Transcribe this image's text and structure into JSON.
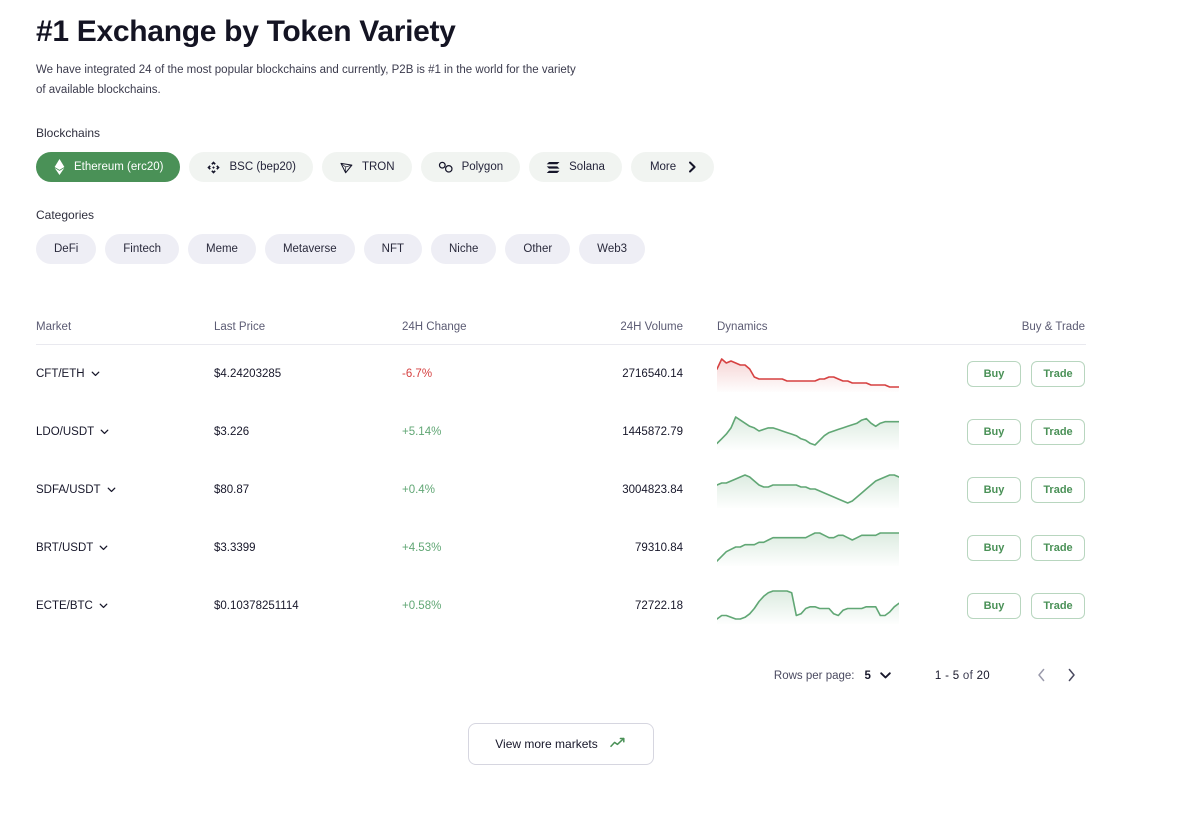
{
  "header": {
    "title": "#1 Exchange by Token Variety",
    "subtitle": "We have integrated 24 of the most popular blockchains and currently, P2B is #1 in the world for the variety of available blockchains."
  },
  "blockchains": {
    "label": "Blockchains",
    "items": [
      {
        "label": "Ethereum (erc20)",
        "icon": "ethereum-icon",
        "active": true
      },
      {
        "label": "BSC (bep20)",
        "icon": "bnb-icon",
        "active": false
      },
      {
        "label": "TRON",
        "icon": "tron-icon",
        "active": false
      },
      {
        "label": "Polygon",
        "icon": "polygon-icon",
        "active": false
      },
      {
        "label": "Solana",
        "icon": "solana-icon",
        "active": false
      }
    ],
    "more_label": "More"
  },
  "categories": {
    "label": "Categories",
    "items": [
      "DeFi",
      "Fintech",
      "Meme",
      "Metaverse",
      "NFT",
      "Niche",
      "Other",
      "Web3"
    ]
  },
  "table": {
    "columns": [
      "Market",
      "Last Price",
      "24H Change",
      "24H Volume",
      "Dynamics",
      "Buy & Trade"
    ],
    "buy_label": "Buy",
    "trade_label": "Trade",
    "rows": [
      {
        "market": "CFT/ETH",
        "price": "$4.24203285",
        "change": "-6.7%",
        "direction": "down",
        "volume": "2716540.14",
        "spark": [
          13,
          8,
          10,
          9,
          10,
          11,
          11,
          13,
          17,
          18,
          18,
          18,
          18,
          18,
          18,
          19,
          19,
          19,
          19,
          19,
          19,
          19,
          18,
          18,
          17,
          17,
          18,
          19,
          19,
          20,
          20,
          20,
          20,
          21,
          21,
          21,
          21,
          22,
          22,
          22
        ]
      },
      {
        "market": "LDO/USDT",
        "price": "$3.226",
        "change": "+5.14%",
        "direction": "up",
        "volume": "1445872.79",
        "spark": [
          26,
          23,
          20,
          16,
          9,
          11,
          13,
          15,
          16,
          18,
          17,
          16,
          16,
          17,
          18,
          19,
          20,
          21,
          23,
          24,
          26,
          27,
          24,
          21,
          19,
          18,
          17,
          16,
          15,
          14,
          13,
          11,
          10,
          13,
          15,
          13,
          12,
          12,
          12,
          12
        ]
      },
      {
        "market": "SDFA/USDT",
        "price": "$80.87",
        "change": "+0.4%",
        "direction": "up",
        "volume": "3004823.84",
        "spark": [
          13,
          12,
          12,
          11,
          10,
          9,
          8,
          9,
          11,
          13,
          14,
          14,
          13,
          13,
          13,
          13,
          13,
          13,
          14,
          14,
          15,
          15,
          16,
          17,
          18,
          19,
          20,
          21,
          22,
          21,
          19,
          17,
          15,
          13,
          11,
          10,
          9,
          8,
          8,
          9
        ]
      },
      {
        "market": "BRT/USDT",
        "price": "$3.3399",
        "change": "+4.53%",
        "direction": "up",
        "volume": "79310.84",
        "spark": [
          22,
          20,
          18,
          17,
          16,
          16,
          15,
          15,
          15,
          14,
          14,
          13,
          12,
          12,
          12,
          12,
          12,
          12,
          12,
          12,
          11,
          10,
          10,
          11,
          12,
          12,
          11,
          11,
          12,
          13,
          12,
          11,
          11,
          11,
          11,
          10,
          10,
          10,
          10,
          10
        ]
      },
      {
        "market": "ECTE/BTC",
        "price": "$0.10378251114",
        "change": "+0.58%",
        "direction": "up",
        "volume": "72722.18",
        "spark": [
          24,
          22,
          22,
          23,
          24,
          24,
          23,
          21,
          18,
          14,
          11,
          9,
          8,
          8,
          8,
          8,
          9,
          22,
          21,
          18,
          17,
          17,
          18,
          18,
          18,
          21,
          22,
          19,
          18,
          18,
          18,
          18,
          17,
          17,
          17,
          22,
          22,
          20,
          17,
          15
        ]
      }
    ]
  },
  "pagination": {
    "rows_per_page_label": "Rows per page:",
    "rows_per_page_value": "5",
    "range": "1 - 5",
    "of_label": "of",
    "total": "20"
  },
  "footer": {
    "view_more_label": "View more markets"
  },
  "colors": {
    "accent_green": "#4a9157",
    "up_green": "#61a775",
    "down_red": "#d64141",
    "chip_bg": "#f1f4f1",
    "category_chip_bg": "#eeeef5"
  }
}
